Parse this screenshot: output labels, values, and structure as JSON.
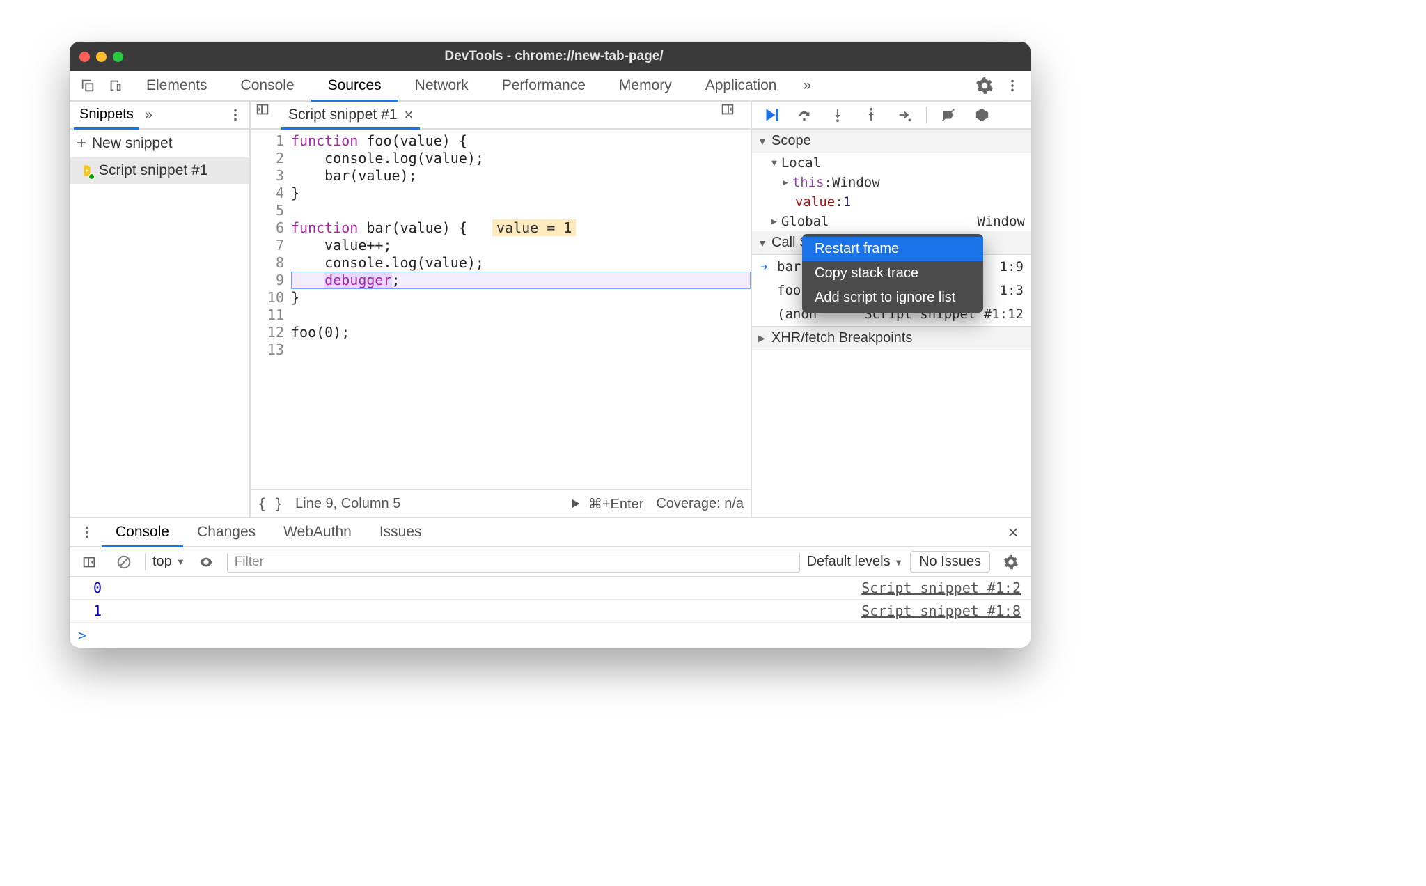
{
  "window": {
    "title": "DevTools - chrome://new-tab-page/"
  },
  "mainTabs": {
    "items": [
      "Elements",
      "Console",
      "Sources",
      "Network",
      "Performance",
      "Memory",
      "Application"
    ],
    "active": "Sources",
    "overflow": "»"
  },
  "leftPanel": {
    "subtab": "Snippets",
    "overflow": "»",
    "newSnippet": "New snippet",
    "items": [
      "Script snippet #1"
    ]
  },
  "editor": {
    "tab": "Script snippet #1",
    "inlineHint": "value = 1",
    "lines": [
      {
        "n": 1,
        "html": "<span class='kw'>function</span> foo(value) {"
      },
      {
        "n": 2,
        "html": "    console.log(value);"
      },
      {
        "n": 3,
        "html": "    bar(value);"
      },
      {
        "n": 4,
        "html": "}"
      },
      {
        "n": 5,
        "html": ""
      },
      {
        "n": 6,
        "html": "<span class='kw'>function</span> bar(value) {   <span class='inline-hint'>value = 1</span>"
      },
      {
        "n": 7,
        "html": "    value++;"
      },
      {
        "n": 8,
        "html": "    console.log(value);"
      },
      {
        "n": 9,
        "html": "    <span class='dbg-kw'>debugger</span>;",
        "hl": true
      },
      {
        "n": 10,
        "html": "}"
      },
      {
        "n": 11,
        "html": ""
      },
      {
        "n": 12,
        "html": "foo(0);"
      },
      {
        "n": 13,
        "html": ""
      }
    ],
    "status": {
      "position": "Line 9, Column 5",
      "runHint": "⌘+Enter",
      "coverage": "Coverage: n/a"
    }
  },
  "debugger": {
    "sections": {
      "scope": "Scope",
      "callstack": "Call Stack",
      "xhr": "XHR/fetch Breakpoints"
    },
    "scope": {
      "local": {
        "label": "Local",
        "this": {
          "key": "this",
          "value": "Window"
        },
        "value": {
          "key": "value",
          "value": "1"
        }
      },
      "global": {
        "label": "Global",
        "rhs": "Window"
      }
    },
    "callstack": [
      {
        "name": "bar",
        "loc": "1:9",
        "current": true,
        "suffix": ""
      },
      {
        "name": "foo",
        "loc": "1:3",
        "current": false
      },
      {
        "name": "(anon",
        "loc": "Script snippet #1:12",
        "current": false,
        "trunc": true
      }
    ],
    "contextMenu": {
      "items": [
        "Restart frame",
        "Copy stack trace",
        "Add script to ignore list"
      ],
      "selected": 0
    }
  },
  "drawer": {
    "tabs": [
      "Console",
      "Changes",
      "WebAuthn",
      "Issues"
    ],
    "active": "Console"
  },
  "console": {
    "context": "top",
    "filterPlaceholder": "Filter",
    "levels": "Default levels",
    "noIssues": "No Issues",
    "rows": [
      {
        "out": "0",
        "src": "Script snippet #1:2"
      },
      {
        "out": "1",
        "src": "Script snippet #1:8"
      }
    ],
    "prompt": ">"
  }
}
